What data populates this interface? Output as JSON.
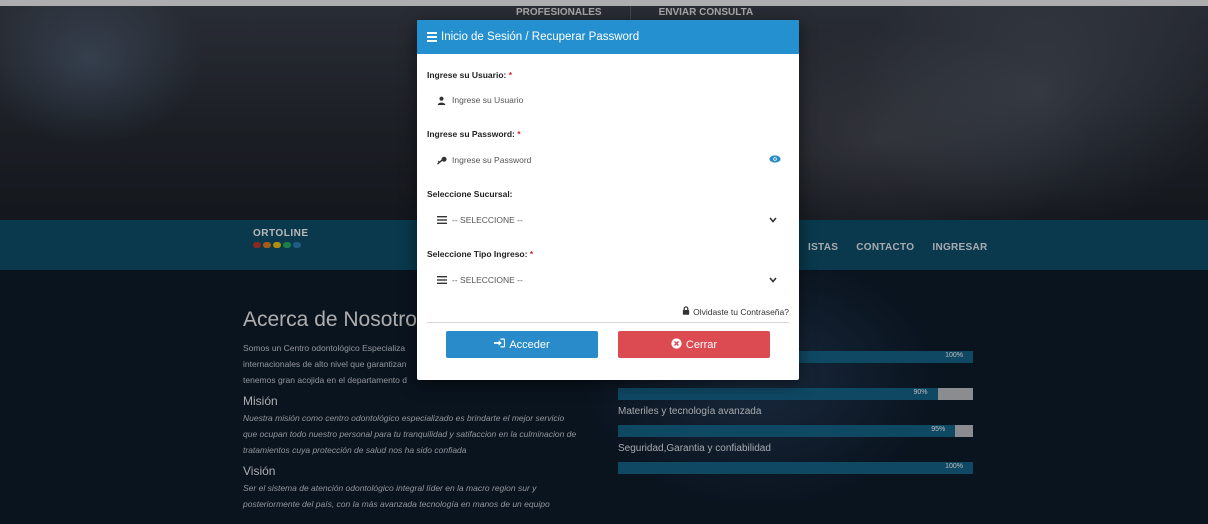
{
  "top_nav": [
    "PROFESIONALES",
    "ENVIAR CONSULTA"
  ],
  "logo_text": "ORTOLINE",
  "logo_colors": [
    "#c0392b",
    "#e67e22",
    "#f1c40f",
    "#27ae60",
    "#2980b9"
  ],
  "main_nav": [
    "ISTAS",
    "CONTACTO",
    "INGRESAR"
  ],
  "about": {
    "title": "Acerca de Nosotros",
    "intro_lines": [
      "Somos un Centro odontológico Especializa",
      "internacionales de alto nivel que garantizan",
      "tenemos gran acojida en el departamento d"
    ],
    "mision_title": "Misión",
    "mision_lines": [
      "Nuestra misión como centro odontológico especializado es brindarte el mejor servicio",
      "que ocupan todo nuestro personal para tu tranquilidad y satifaccion en la culminacion de",
      "tratamientos cuya protección de salud nos ha sido confiada"
    ],
    "vision_title": "Visión",
    "vision_lines": [
      "Ser el sistema de atención odontológico integral líder en la macro region sur y",
      "posteriormente del país, con la más avanzada tecnología en manos de un equipo"
    ]
  },
  "skills": [
    {
      "label": "",
      "percent": 100,
      "pct_text": "100%"
    },
    {
      "label": "",
      "percent": 90,
      "pct_text": "90%"
    },
    {
      "label": "Materiles y tecnología avanzada",
      "percent": 95,
      "pct_text": "95%"
    },
    {
      "label": "Seguridad,Garantia y confiabilidad",
      "percent": 100,
      "pct_text": "100%"
    }
  ],
  "modal": {
    "title": "Inicio de Sesión / Recuperar Password",
    "user_label": "Ingrese su Usuario:",
    "user_placeholder": "Ingrese su Usuario",
    "password_label": "Ingrese su Password:",
    "password_placeholder": "Ingrese su Password",
    "branch_label": "Seleccione Sucursal:",
    "branch_value": "-- SELECCIONE --",
    "type_label": "Seleccione Tipo Ingreso:",
    "type_value": "-- SELECCIONE --",
    "required_mark": "*",
    "forgot": "Olvidaste tu Contraseña?",
    "login_button": "Acceder",
    "close_button": "Cerrar"
  },
  "colors": {
    "header": "#2590cf",
    "login": "#2a8bcb",
    "close": "#dd4b52",
    "navbar": "#0f4f6b"
  }
}
